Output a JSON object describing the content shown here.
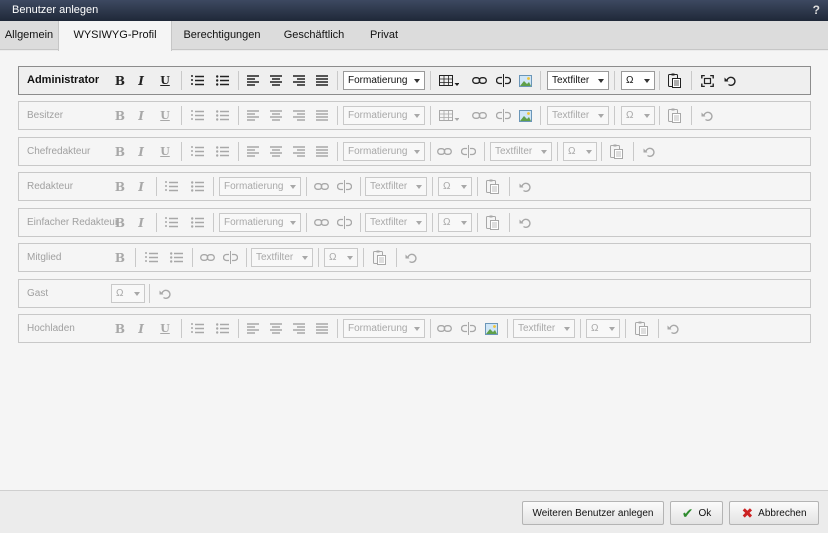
{
  "window": {
    "title": "Benutzer anlegen",
    "help": "?"
  },
  "tabs": [
    {
      "label": "Allgemein"
    },
    {
      "label": "WYSIWYG-Profil"
    },
    {
      "label": "Berechtigungen"
    },
    {
      "label": "Geschäftlich"
    },
    {
      "label": "Privat"
    }
  ],
  "active_tab": "WYSIWYG-Profil",
  "toolbar_text": {
    "format": "Formatierung",
    "textfilter": "Textfilter",
    "omega": "Ω",
    "bold": "B",
    "italic": "I",
    "underline": "U"
  },
  "roles": [
    {
      "label": "Administrator",
      "active": true
    },
    {
      "label": "Besitzer"
    },
    {
      "label": "Chefredakteur"
    },
    {
      "label": "Redakteur"
    },
    {
      "label": "Einfacher Redakteur"
    },
    {
      "label": "Mitglied"
    },
    {
      "label": "Gast"
    },
    {
      "label": "Hochladen"
    }
  ],
  "footer": {
    "more_users": "Weiteren Benutzer anlegen",
    "ok": "Ok",
    "ok_icon": "✔",
    "cancel": "Abbrechen",
    "cancel_icon": "✖"
  },
  "colors": {
    "ok_green": "#2e8b2e",
    "cancel_red": "#cc2222",
    "titlebar": "#2a3347"
  }
}
